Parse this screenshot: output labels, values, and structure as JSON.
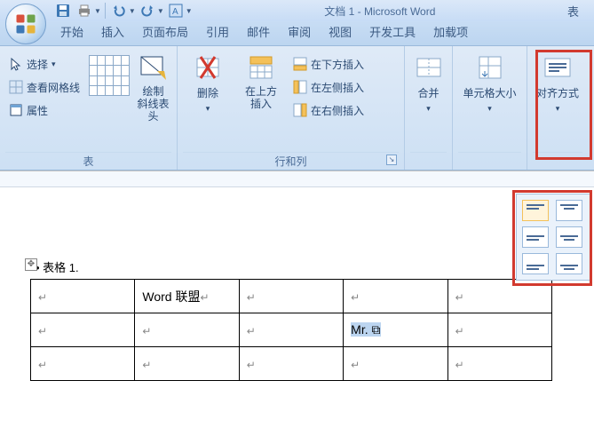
{
  "title_doc": "文档 1 - Microsoft Word",
  "title_context": "表",
  "qat": {
    "save": "save-icon",
    "undo": "undo-icon",
    "redo": "redo-icon"
  },
  "tabs": [
    "开始",
    "插入",
    "页面布局",
    "引用",
    "邮件",
    "审阅",
    "视图",
    "开发工具",
    "加载项"
  ],
  "ribbon": {
    "group_table": {
      "label": "表",
      "select": "选择",
      "select_drop": "▾",
      "gridlines": "查看网格线",
      "properties": "属性",
      "draw": "绘制\n斜线表头"
    },
    "group_rowscols": {
      "label": "行和列",
      "delete": "删除",
      "insert_above": "在上方\n插入",
      "insert_below": "在下方插入",
      "insert_left": "在左侧插入",
      "insert_right": "在右侧插入"
    },
    "group_merge": {
      "merge": "合并"
    },
    "group_cellsize": {
      "cellsize": "单元格大小"
    },
    "group_align": {
      "align": "对齐方式"
    }
  },
  "doc": {
    "caption": "表格 1",
    "cells": {
      "r0c1": "Word 联盟",
      "r1c3": "Mr."
    }
  }
}
